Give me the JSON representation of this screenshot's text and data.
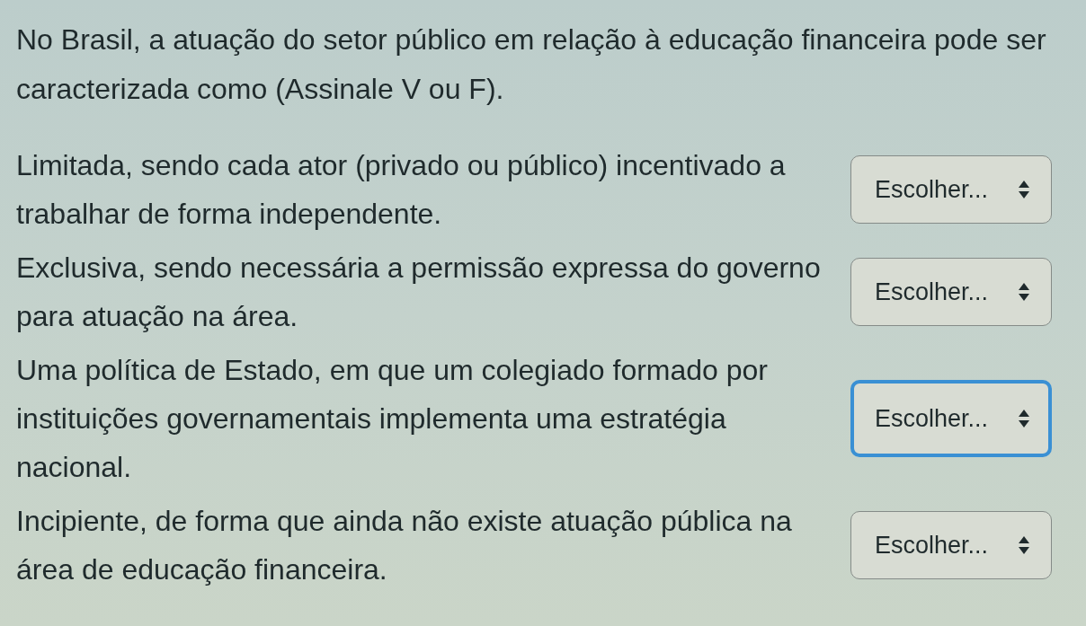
{
  "question": "No Brasil, a atuação do setor público em relação à educação financeira pode ser caracterizada como (Assinale V ou F).",
  "statements": [
    {
      "text": "Limitada, sendo cada ator (privado ou público) incentivado a trabalhar de forma independente.",
      "select": {
        "value": "Escolher...",
        "focused": false
      }
    },
    {
      "text": "Exclusiva, sendo necessária a permissão expressa do governo para atuação na área.",
      "select": {
        "value": "Escolher...",
        "focused": false
      }
    },
    {
      "text": "Uma política de Estado, em que um colegiado formado por instituições governamentais implementa uma estratégia nacional.",
      "select": {
        "value": "Escolher...",
        "focused": true
      }
    },
    {
      "text": "Incipiente, de forma que ainda não existe atuação pública na área de educação financeira.",
      "select": {
        "value": "Escolher...",
        "focused": false
      }
    }
  ]
}
